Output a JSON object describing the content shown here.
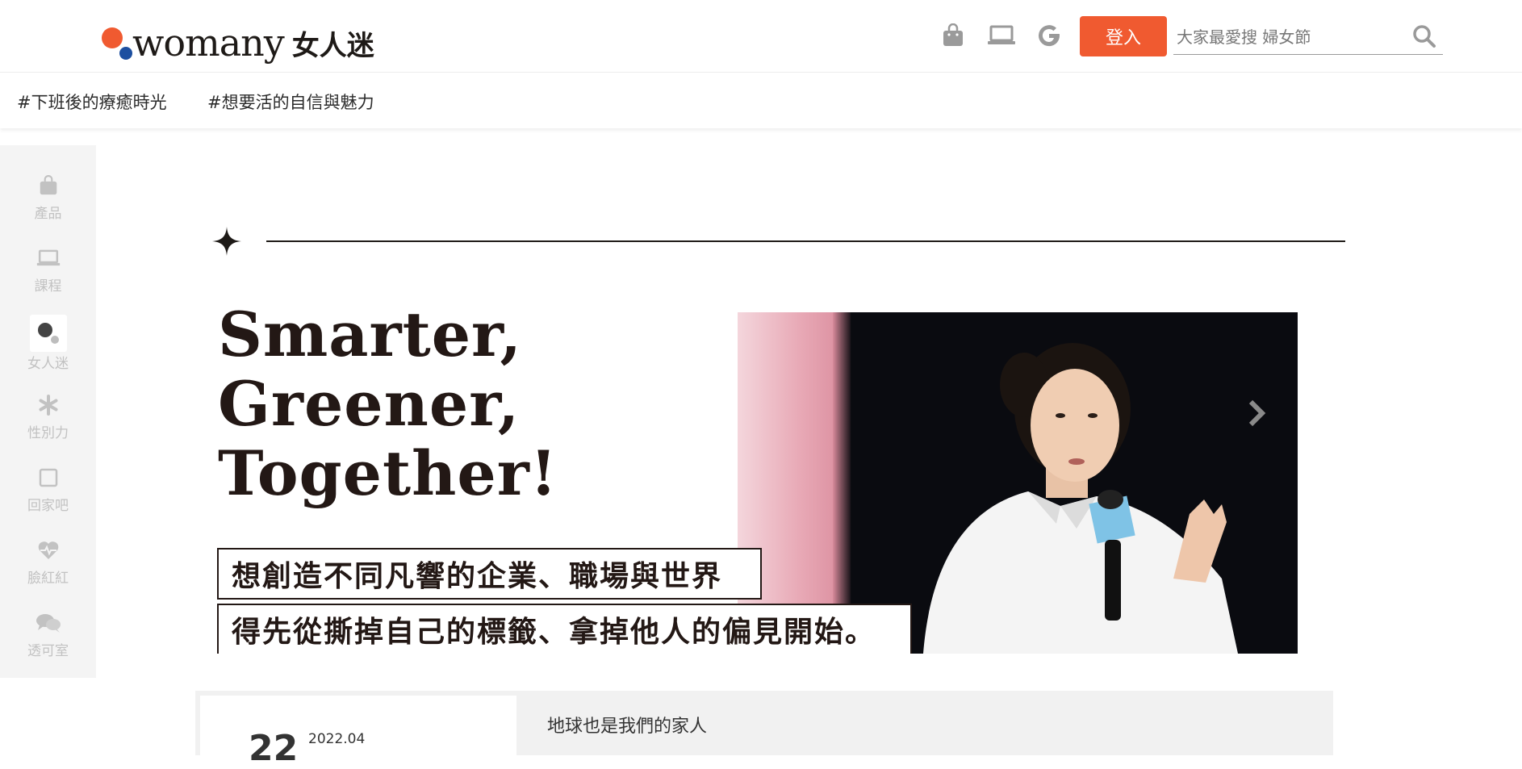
{
  "header": {
    "logo_text": "womany",
    "logo_cn": "女人迷",
    "icons": [
      "bag-icon",
      "laptop-icon",
      "google-icon"
    ],
    "login_label": "登入",
    "search_placeholder": "大家最愛搜 婦女節"
  },
  "tags": [
    "#下班後的療癒時光",
    "#想要活的自信與魅力"
  ],
  "rail": {
    "items": [
      {
        "label": "產品",
        "icon": "bag-icon"
      },
      {
        "label": "課程",
        "icon": "laptop-icon"
      },
      {
        "label": "女人迷",
        "icon": "womany-logo-icon"
      },
      {
        "label": "性別力",
        "icon": "asterisk-icon"
      },
      {
        "label": "回家吧",
        "icon": "square-icon"
      },
      {
        "label": "臉紅紅",
        "icon": "heartbeat-icon"
      },
      {
        "label": "透可室",
        "icon": "chat-bubbles-icon"
      }
    ]
  },
  "banner": {
    "headline": [
      "Smarter,",
      "Greener,",
      "Together!"
    ],
    "quote_line1": "想創造不同凡響的企業、職場與世界",
    "quote_line2": "得先從撕掉自己的標籤、拿掉他人的偏見開始。"
  },
  "card": {
    "day": "22",
    "year_month": "2022.04",
    "title": "地球也是我們的家人"
  },
  "colors": {
    "brand_orange": "#f05a30",
    "brand_blue": "#1c4fa0",
    "ink": "#231815"
  }
}
